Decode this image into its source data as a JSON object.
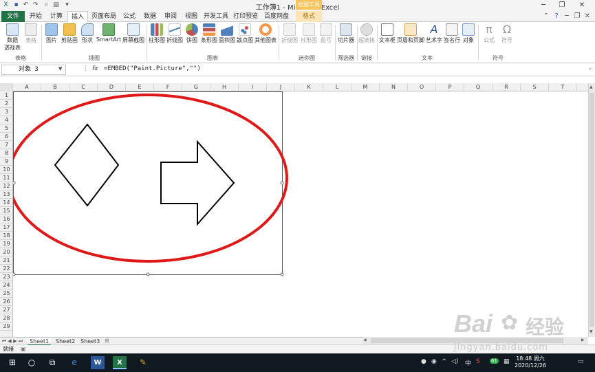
{
  "window": {
    "title": "工作簿1 - Microsoft Excel",
    "context_tab_group": "绘图工具"
  },
  "ribbon_tabs": [
    "文件",
    "开始",
    "计算",
    "插入",
    "页面布局",
    "公式",
    "数据",
    "审阅",
    "视图",
    "开发工具",
    "打印预览",
    "百度网盘",
    "格式"
  ],
  "active_tab": "插入",
  "ribbon": {
    "groups": [
      {
        "label": "表格",
        "buttons": [
          "数据\n透视表",
          "表格"
        ]
      },
      {
        "label": "插图",
        "buttons": [
          "图片",
          "剪贴画",
          "形状",
          "SmartArt",
          "屏幕截图"
        ]
      },
      {
        "label": "图表",
        "buttons": [
          "柱形图",
          "折线图",
          "饼图",
          "条形图",
          "面积图",
          "散点图",
          "其他图表"
        ]
      },
      {
        "label": "迷你图",
        "buttons": [
          "折线图",
          "柱形图",
          "盈亏"
        ]
      },
      {
        "label": "筛选器",
        "buttons": [
          "切片器"
        ]
      },
      {
        "label": "链接",
        "buttons": [
          "超链接"
        ]
      },
      {
        "label": "文本",
        "buttons": [
          "文本框",
          "页眉和页脚",
          "艺术字",
          "签名行",
          "对象"
        ]
      },
      {
        "label": "符号",
        "buttons": [
          "公式",
          "符号"
        ]
      }
    ]
  },
  "formula_bar": {
    "name_box": "对象 3",
    "fx": "fx",
    "formula": "=EMBED(\"Paint.Picture\",\"\")"
  },
  "columns": [
    "A",
    "B",
    "C",
    "D",
    "E",
    "F",
    "G",
    "H",
    "I",
    "J",
    "K",
    "L",
    "M",
    "N",
    "O",
    "P",
    "Q",
    "R",
    "S",
    "T"
  ],
  "rows": [
    "1",
    "2",
    "3",
    "4",
    "5",
    "6",
    "7",
    "8",
    "9",
    "10",
    "11",
    "12",
    "13",
    "14",
    "15",
    "16",
    "17",
    "18",
    "19",
    "20",
    "21",
    "22",
    "23",
    "24",
    "25",
    "26",
    "27",
    "28",
    "29"
  ],
  "sheets": [
    "Sheet1",
    "Sheet2",
    "Sheet3"
  ],
  "active_sheet": "Sheet1",
  "status": {
    "mode": "就绪"
  },
  "taskbar": {
    "tray_items": [
      "中",
      "S"
    ],
    "clock_time": "18:48 周六",
    "clock_date": "2020/12/26",
    "notify_count": "61"
  },
  "watermark": {
    "brand": "Bai",
    "brand2": "经验",
    "url": "jingyan.baidu.com"
  },
  "colors": {
    "accent": "#217346",
    "ellipse": "#e11818",
    "taskbar": "#101820"
  }
}
